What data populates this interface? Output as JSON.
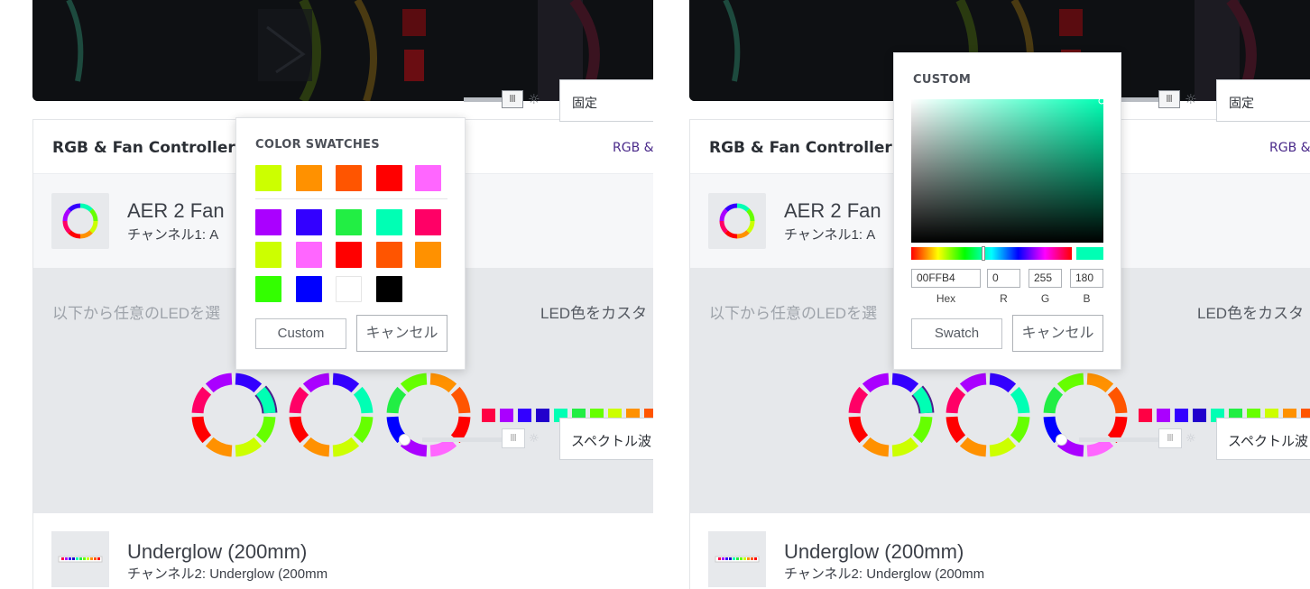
{
  "card": {
    "title": "RGB & Fan Controller",
    "link": "RGB &"
  },
  "device1": {
    "name": "AER 2 Fan",
    "channel": "チャンネル1: A",
    "mode": "固定",
    "slider_icon": "Ⅲ",
    "brightness_icon": "sun-icon"
  },
  "zone": {
    "left_text": "以下から任意のLEDを選",
    "right_text": "LED色をカスタ"
  },
  "device2": {
    "name": "Underglow (200mm)",
    "channel": "チャンネル2: Underglow (200mm",
    "mode": "スペクトル波"
  },
  "swatches_popup": {
    "title": "COLOR SWATCHES",
    "top_row": [
      "#ccff00",
      "#ff9100",
      "#ff5500",
      "#ff0000",
      "#ff66ff"
    ],
    "grid": [
      [
        "#aa00ff",
        "#3300ff",
        "#22ee44",
        "#00ffb4",
        "#ff0066"
      ],
      [
        "#ccff00",
        "#ff66ff",
        "#ff0000",
        "#ff5500",
        "#ff9100"
      ],
      [
        "#33ff00",
        "#0000ff",
        "#ffffff",
        "#000000"
      ]
    ],
    "custom_button": "Custom",
    "cancel_button": "キャンセル"
  },
  "custom_popup": {
    "title": "CUSTOM",
    "hex_value": "00FFB4",
    "r_value": "0",
    "g_value": "255",
    "b_value": "180",
    "hex_label": "Hex",
    "r_label": "R",
    "g_label": "G",
    "b_label": "B",
    "swatch_button": "Swatch",
    "cancel_button": "キャンセル",
    "selected_color": "#00ffb4"
  },
  "led_strip_colors": [
    "#ff0044",
    "#aa00ff",
    "#3300ff",
    "#2200cc",
    "#00ffb4",
    "#22ee44",
    "#66ff00",
    "#ccff00",
    "#ff9100",
    "#ff5500",
    "#ff0000"
  ],
  "fan_ring_colors": [
    [
      "#3300ff",
      "#00ffb4",
      "#66ff00",
      "#ccff00",
      "#ff9100",
      "#ff0000",
      "#ff0066",
      "#aa00ff"
    ],
    [
      "#3300ff",
      "#00ffb4",
      "#66ff00",
      "#ccff00",
      "#ff9100",
      "#ff0000",
      "#ff0066",
      "#aa00ff"
    ],
    [
      "#ff9100",
      "#ff5500",
      "#ff0000",
      "#ff66ff",
      "#aa00ff",
      "#0000ff",
      "#22ee44",
      "#66ff00"
    ]
  ]
}
